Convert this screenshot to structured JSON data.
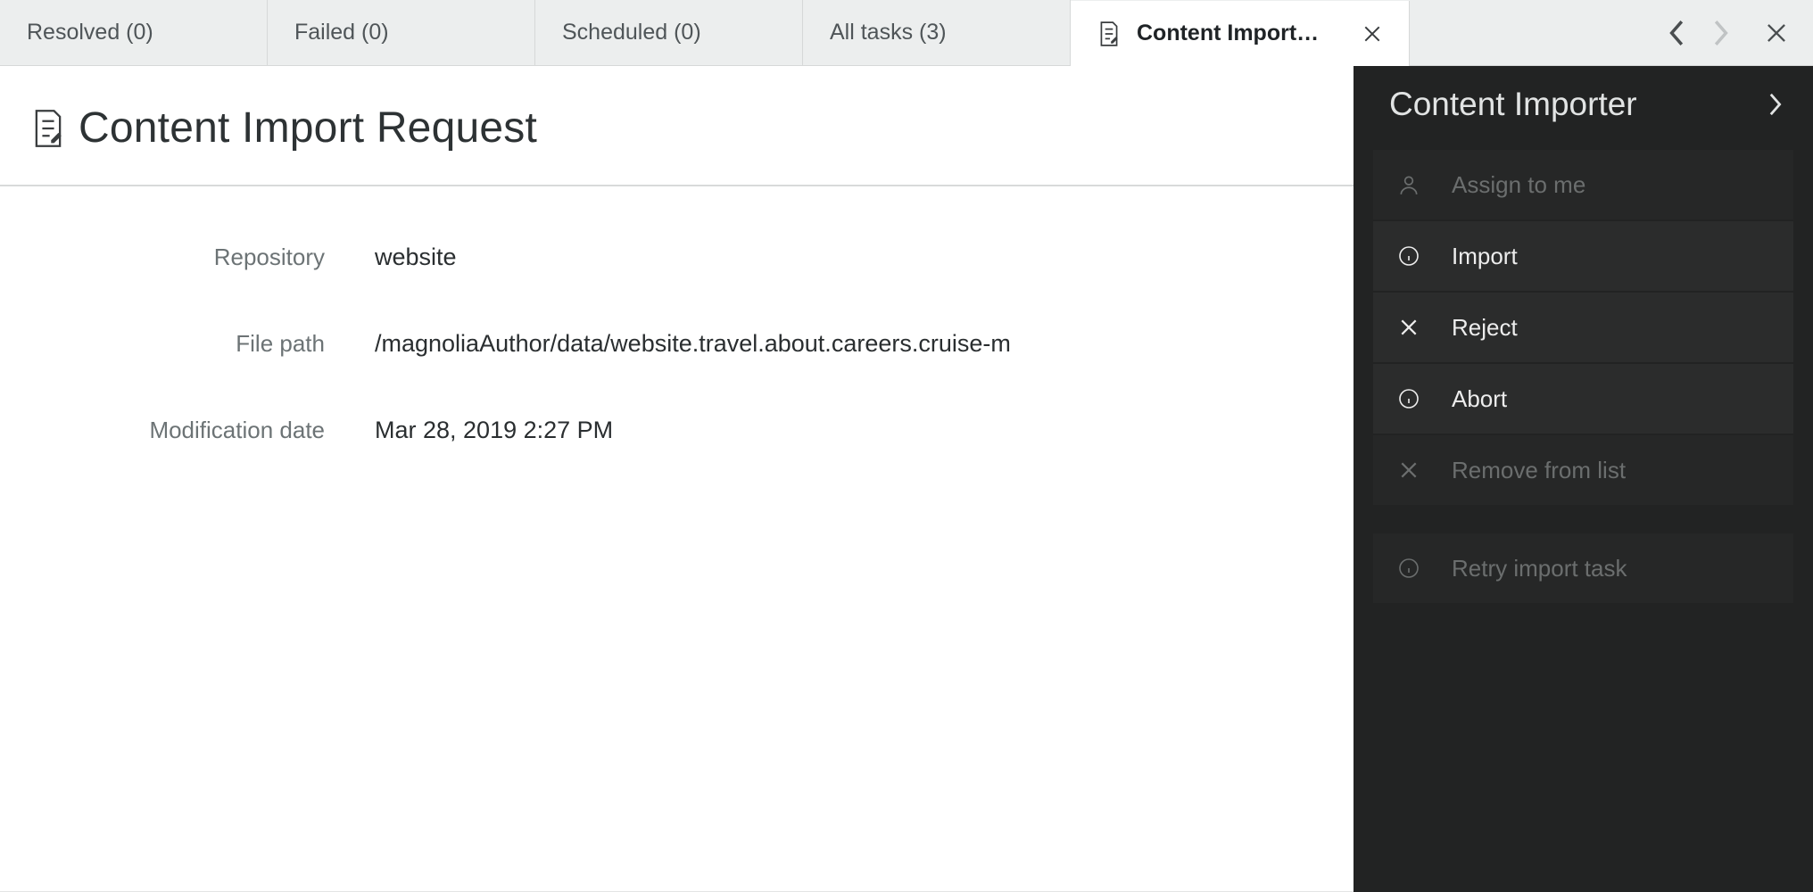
{
  "tabs": [
    {
      "label": "Resolved (0)"
    },
    {
      "label": "Failed (0)"
    },
    {
      "label": "Scheduled (0)"
    },
    {
      "label": "All tasks (3)"
    },
    {
      "label": "Content Import Re...",
      "active": true
    }
  ],
  "page": {
    "title": "Content Import Request"
  },
  "details": {
    "repository_label": "Repository",
    "repository_value": "website",
    "filepath_label": "File path",
    "filepath_value": "/magnoliaAuthor/data/website.travel.about.careers.cruise-m",
    "moddate_label": "Modification date",
    "moddate_value": "Mar 28, 2019 2:27 PM"
  },
  "sidepanel": {
    "title": "Content Importer",
    "actions": {
      "assign": "Assign to me",
      "import": "Import",
      "reject": "Reject",
      "abort": "Abort",
      "remove": "Remove from list",
      "retry": "Retry import task"
    }
  }
}
